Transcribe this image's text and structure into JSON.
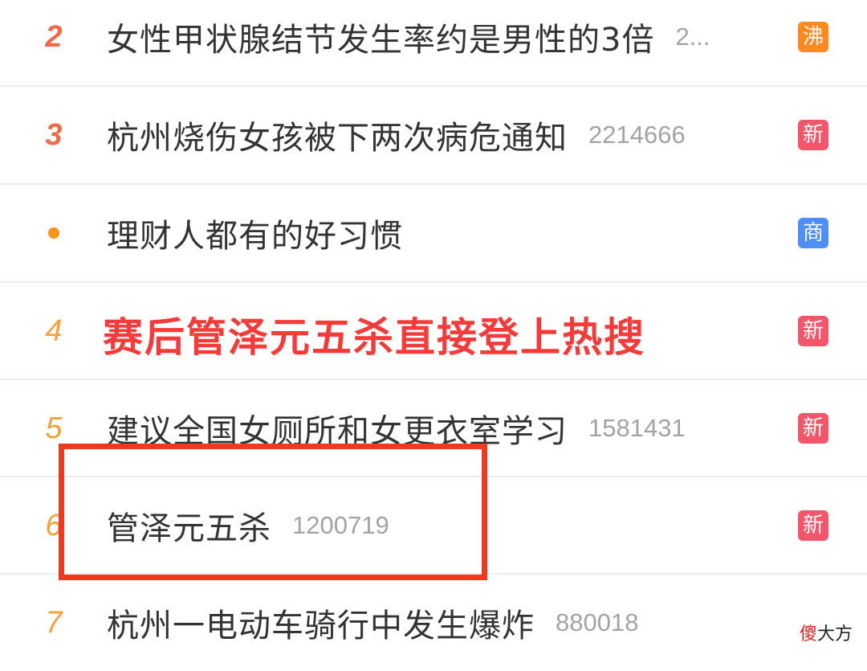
{
  "rows": [
    {
      "rank": "2",
      "title": "女性甲状腺结节发生率约是男性的3倍",
      "count": "2...",
      "badge": "沸"
    },
    {
      "rank": "3",
      "title": "杭州烧伤女孩被下两次病危通知",
      "count": "2214666",
      "badge": "新"
    },
    {
      "rank": "",
      "title": "理财人都有的好习惯",
      "count": "",
      "badge": "商"
    },
    {
      "rank": "4",
      "title": "",
      "count": "",
      "badge": "新"
    },
    {
      "rank": "5",
      "title": "建议全国女厕所和女更衣室学习",
      "count": "1581431",
      "badge": "新"
    },
    {
      "rank": "6",
      "title": "管泽元五杀",
      "count": "1200719",
      "badge": "新"
    },
    {
      "rank": "7",
      "title": "杭州一电动车骑行中发生爆炸",
      "count": "880018",
      "badge": ""
    }
  ],
  "overlay_caption": "赛后管泽元五杀直接登上热搜",
  "watermark": {
    "part1": "傻",
    "part2": "大方"
  },
  "colors": {
    "rank_top": "#f06a48",
    "rank_normal": "#f5a13a",
    "badge_hot": "#ff8a1f",
    "badge_new": "#f2566a",
    "badge_ad": "#4d8ff2",
    "highlight_box": "#f03a20",
    "overlay_text": "#f53a3a"
  }
}
